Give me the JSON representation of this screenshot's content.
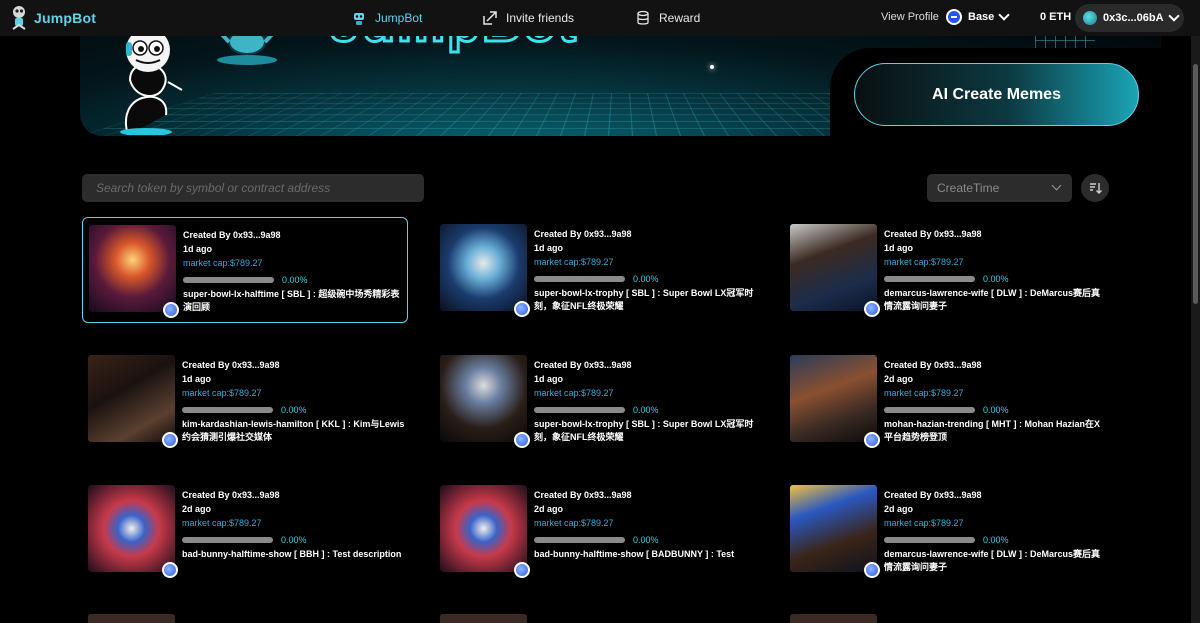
{
  "app": {
    "name": "JumpBot"
  },
  "nav": {
    "items": [
      {
        "label": "JumpBot",
        "icon": "robot-icon"
      },
      {
        "label": "Invite friends",
        "icon": "share-arrow-icon"
      },
      {
        "label": "Reward",
        "icon": "coin-stack-icon"
      }
    ],
    "view_profile": "View Profile",
    "network": "Base",
    "balance": "0 ETH",
    "wallet": "0x3c...06bA"
  },
  "banner": {
    "cta": "AI Create Memes"
  },
  "search": {
    "placeholder": "Search token by symbol or contract address"
  },
  "sort": {
    "selected": "CreateTime"
  },
  "colors": {
    "accent": "#5fd3e8",
    "market_cap": "#3aa9d8",
    "background": "#000000"
  },
  "cards": [
    {
      "creator": "Created By 0x93...9a98",
      "ago": "1d ago",
      "market_cap": "market cap:$789.27",
      "progress": 0.0,
      "progress_label": "0.00%",
      "description": "super-bowl-lx-halftime [ SBL ] : 超级碗中场秀精彩表演回顾",
      "thumb": "halftime-show-image",
      "selected": true
    },
    {
      "creator": "Created By 0x93...9a98",
      "ago": "1d ago",
      "market_cap": "market cap:$789.27",
      "progress": 0.0,
      "progress_label": "0.00%",
      "description": "super-bowl-lx-trophy [ SBL ] : Super Bowl LX冠军时刻，象征NFL终极荣耀",
      "thumb": "trophy-stage-image"
    },
    {
      "creator": "Created By 0x93...9a98",
      "ago": "1d ago",
      "market_cap": "market cap:$789.27",
      "progress": 0.0,
      "progress_label": "0.00%",
      "description": "demarcus-lawrence-wife [ DLW ] : DeMarcus赛后真情流露询问妻子",
      "thumb": "football-player-image"
    },
    {
      "creator": "Created By 0x93...9a98",
      "ago": "1d ago",
      "market_cap": "market cap:$789.27",
      "progress": 0.0,
      "progress_label": "0.00%",
      "description": "kim-kardashian-lewis-hamilton [ KKL ] : Kim与Lewis约会猜测引爆社交媒体",
      "thumb": "celebrity-crowd-image"
    },
    {
      "creator": "Created By 0x93...9a98",
      "ago": "1d ago",
      "market_cap": "market cap:$789.27",
      "progress": 0.0,
      "progress_label": "0.00%",
      "description": "super-bowl-lx-trophy [ SBL ] : Super Bowl LX冠军时刻，象征NFL终极荣耀",
      "thumb": "trophy-spotlight-image"
    },
    {
      "creator": "Created By 0x93...9a98",
      "ago": "2d ago",
      "market_cap": "market cap:$789.27",
      "progress": 0.0,
      "progress_label": "0.00%",
      "description": "mohan-hazian-trending [ MHT ] : Mohan Hazian在X平台趋势榜登顶",
      "thumb": "stadium-crowd-image"
    },
    {
      "creator": "Created By 0x93...9a98",
      "ago": "2d ago",
      "market_cap": "market cap:$789.27",
      "progress": 0.0,
      "progress_label": "0.00%",
      "description": "bad-bunny-halftime-show [ BBH ] : Test description",
      "thumb": "halftime-flag-image"
    },
    {
      "creator": "Created By 0x93...9a98",
      "ago": "2d ago",
      "market_cap": "market cap:$789.27",
      "progress": 0.0,
      "progress_label": "0.00%",
      "description": "bad-bunny-halftime-show [ BADBUNNY ] : Test",
      "thumb": "halftime-flag-image"
    },
    {
      "creator": "Created By 0x93...9a98",
      "ago": "2d ago",
      "market_cap": "market cap:$789.27",
      "progress": 0.0,
      "progress_label": "0.00%",
      "description": "demarcus-lawrence-wife [ DLW ] : DeMarcus赛后真情流露询问妻子",
      "thumb": "champions-player-image"
    }
  ]
}
